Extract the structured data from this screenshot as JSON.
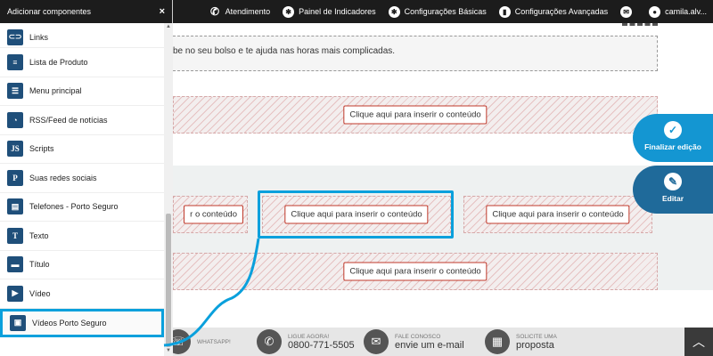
{
  "topbar": {
    "items": [
      {
        "label": "Atendimento",
        "icon": "phone-icon"
      },
      {
        "label": "Painel de Indicadores",
        "icon": "gear-icon"
      },
      {
        "label": "Configurações Básicas",
        "icon": "gear-icon"
      },
      {
        "label": "Configurações Avançadas",
        "icon": "document-icon"
      },
      {
        "label": "",
        "icon": "mail-icon"
      },
      {
        "label": "camila.alv...",
        "icon": "user-icon"
      }
    ]
  },
  "drawer": {
    "title": "Adicionar componentes",
    "close": "×",
    "items": [
      {
        "label": "Links",
        "icon": "link-icon",
        "glyph": "⊂⊃"
      },
      {
        "label": "Lista de Produto",
        "icon": "list-icon",
        "glyph": "≡"
      },
      {
        "label": "Menu principal",
        "icon": "menu-icon",
        "glyph": "☰"
      },
      {
        "label": "RSS/Feed de notícias",
        "icon": "rss-icon",
        "glyph": "◔"
      },
      {
        "label": "Scripts",
        "icon": "script-icon",
        "glyph": "JS"
      },
      {
        "label": "Suas redes sociais",
        "icon": "social-icon",
        "glyph": "P"
      },
      {
        "label": "Telefones - Porto Seguro",
        "icon": "phone-list-icon",
        "glyph": "▤"
      },
      {
        "label": "Texto",
        "icon": "text-icon",
        "glyph": "T"
      },
      {
        "label": "Título",
        "icon": "title-icon",
        "glyph": "▬"
      },
      {
        "label": "Vídeo",
        "icon": "video-icon",
        "glyph": "▶"
      },
      {
        "label": "Vídeos Porto Seguro",
        "icon": "video-porto-icon",
        "glyph": "▣"
      }
    ]
  },
  "canvas": {
    "text_snippet": "be no seu bolso e te ajuda nas horas mais complicadas.",
    "insert_label": "Clique aqui para inserir o conteúdo",
    "insert_label_partial": "r o conteúdo"
  },
  "fabs": {
    "finish": "Finalizar edição",
    "edit": "Editar"
  },
  "footer": {
    "whatsapp": {
      "small": "WHATSAPP!",
      "big": ""
    },
    "call": {
      "small": "LIGUE AGORA!",
      "big": "0800-771-5505"
    },
    "contact": {
      "small": "FALE CONOSCO",
      "big": "envie um e-mail"
    },
    "quote": {
      "small": "SOLICITE UMA",
      "big": "proposta"
    }
  },
  "colors": {
    "highlight": "#0aa0dc",
    "fab": "#1496d2",
    "topbar": "#1c1c1c"
  }
}
